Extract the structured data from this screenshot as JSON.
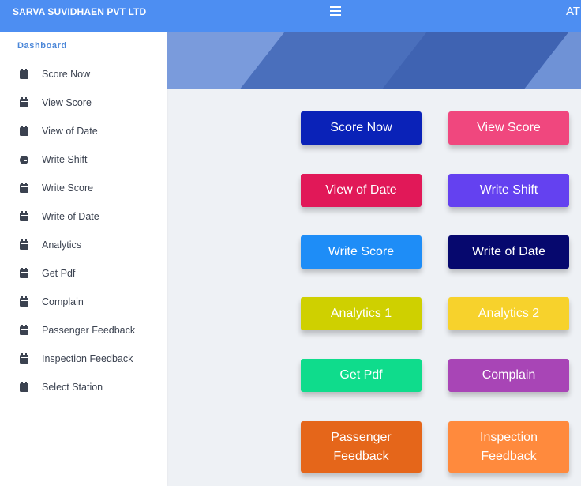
{
  "header": {
    "brand": "SARVA SUVIDHAEN PVT LTD",
    "right_text": "AT",
    "color": "#4d8ef2"
  },
  "sidebar": {
    "heading": "Dashboard",
    "items": [
      {
        "label": "Score Now",
        "icon": "calendar-icon"
      },
      {
        "label": "View Score",
        "icon": "calendar-icon"
      },
      {
        "label": "View of Date",
        "icon": "calendar-icon"
      },
      {
        "label": "Write Shift",
        "icon": "clock-icon"
      },
      {
        "label": "Write Score",
        "icon": "calendar-icon"
      },
      {
        "label": "Write of Date",
        "icon": "calendar-icon"
      },
      {
        "label": "Analytics",
        "icon": "calendar-icon"
      },
      {
        "label": "Get Pdf",
        "icon": "calendar-icon"
      },
      {
        "label": "Complain",
        "icon": "calendar-icon"
      },
      {
        "label": "Passenger Feedback",
        "icon": "calendar-icon"
      },
      {
        "label": "Inspection Feedback",
        "icon": "calendar-icon"
      },
      {
        "label": "Select Station",
        "icon": "calendar-icon"
      }
    ]
  },
  "tiles": [
    {
      "line1": "Score Now",
      "line2": "",
      "color": "#0a22b8"
    },
    {
      "line1": "View Score",
      "line2": "",
      "color": "#f0477e"
    },
    {
      "line1": "View of Date",
      "line2": "",
      "color": "#e11858"
    },
    {
      "line1": "Write Shift",
      "line2": "",
      "color": "#6441f0"
    },
    {
      "line1": "Write Score",
      "line2": "",
      "color": "#1e8df7"
    },
    {
      "line1": "Write of Date",
      "line2": "",
      "color": "#06086e"
    },
    {
      "line1": "Analytics 1",
      "line2": "",
      "color": "#cfd000"
    },
    {
      "line1": "Analytics 2",
      "line2": "",
      "color": "#f7d22c"
    },
    {
      "line1": "Get Pdf",
      "line2": "",
      "color": "#0fdc8c"
    },
    {
      "line1": "Complain",
      "line2": "",
      "color": "#a845b6"
    },
    {
      "line1": "Passenger",
      "line2": "Feedback",
      "color": "#e5661a"
    },
    {
      "line1": "Inspection",
      "line2": "Feedback",
      "color": "#ff8a3d"
    }
  ]
}
